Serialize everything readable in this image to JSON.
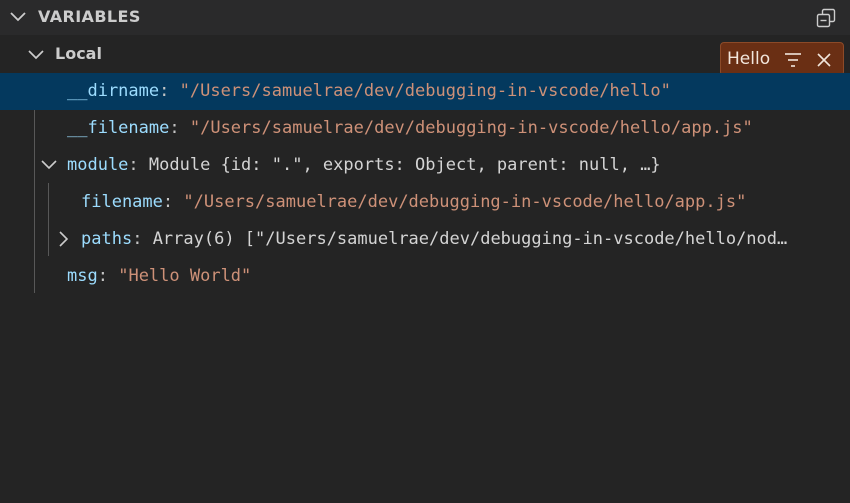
{
  "panel": {
    "title": "VARIABLES",
    "scope_label": "Local"
  },
  "filter": {
    "value": "Hello"
  },
  "variables": [
    {
      "name": "__dirname",
      "separator": ":",
      "value": "\"/Users/samuelrae/dev/debugging-in-vscode/hello\""
    },
    {
      "name": "__filename",
      "separator": ":",
      "value": "\"/Users/samuelrae/dev/debugging-in-vscode/hello/app.js\""
    },
    {
      "name": "module",
      "separator": ":",
      "value": "Module {id: \".\", exports: Object, parent: null, …}"
    },
    {
      "name": "filename",
      "separator": ":",
      "value": "\"/Users/samuelrae/dev/debugging-in-vscode/hello/app.js\""
    },
    {
      "name": "paths",
      "separator": ":",
      "value": "Array(6) [\"/Users/samuelrae/dev/debugging-in-vscode/hello/nod…"
    },
    {
      "name": "msg",
      "separator": ":",
      "value": "\"Hello World\""
    }
  ],
  "colors": {
    "background": "#242424",
    "selected_row": "#04395e",
    "filter_badge": "#6a2f14",
    "variable_name": "#9cdcfe",
    "string_value": "#ce9178"
  },
  "icons": [
    "chevron-down-icon",
    "collapse-all-icon",
    "filter-icon",
    "close-icon",
    "chevron-right-icon"
  ]
}
